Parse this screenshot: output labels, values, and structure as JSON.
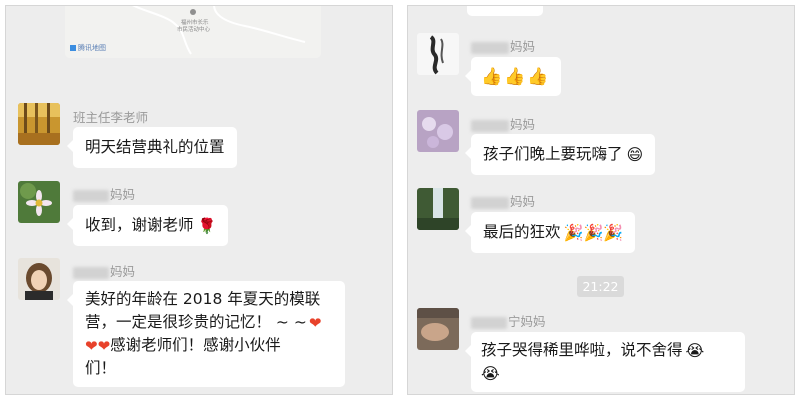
{
  "left_panel": {
    "map_card": {
      "location_line1": "福州市长乐",
      "location_line2": "市民活动中心",
      "credit": "腾讯地图"
    },
    "messages": [
      {
        "sender": "班主任李老师",
        "text": "明天结营典礼的位置",
        "emoji": ""
      },
      {
        "sender": "妈妈",
        "text": "收到，谢谢老师",
        "emoji": "🌹"
      },
      {
        "sender": "妈妈",
        "lines": [
          "美好的年龄在 2018 年夏天的模联",
          "营，一定是很珍贵的记忆！ ~ ~",
          "感谢老师们！感谢小伙伴",
          "们！"
        ],
        "line2_emoji": "❤",
        "line3_emoji": "❤❤"
      }
    ]
  },
  "right_panel": {
    "messages": [
      {
        "sender": "妈妈",
        "text": "",
        "emoji": "👍👍👍"
      },
      {
        "sender": "妈妈",
        "text": "孩子们晚上要玩嗨了",
        "emoji": "😄"
      },
      {
        "sender": "妈妈",
        "text": "最后的狂欢",
        "emoji": "🎉🎉🎉"
      },
      {
        "sender": "宁妈妈",
        "lines": [
          "孩子哭得稀里哗啦，说不舍得",
          ""
        ],
        "line1_emoji": "😭",
        "line2_emoji": "😭"
      }
    ],
    "timestamp": "21:22"
  },
  "colors": {
    "panel_bg": "#ededed",
    "bubble_bg": "#ffffff",
    "name_text": "#9a9a9a",
    "timestamp_bg": "#dadada"
  }
}
